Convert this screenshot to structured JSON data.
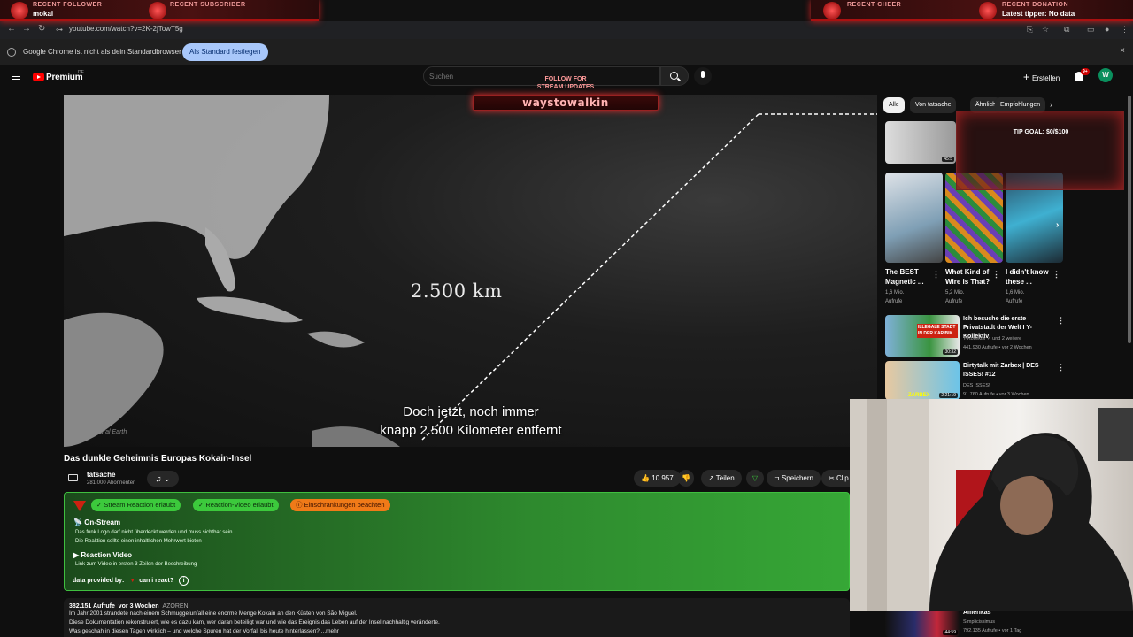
{
  "stream_overlay": {
    "recent_follower_label": "RECENT FOLLOWER",
    "recent_follower_name": "mokai",
    "recent_subscriber_label": "RECENT SUBSCRIBER",
    "recent_cheer_label": "RECENT CHEER",
    "recent_donation_label": "RECENT DONATION",
    "latest_tipper": "Latest tipper: No data",
    "follow_line1": "FOLLOW FOR",
    "follow_line2": "STREAM UPDATES",
    "channel_banner": "waystowalkin",
    "tip_goal": "TIP GOAL: $0/$100"
  },
  "browser": {
    "url": "youtube.com/watch?v=2K-2jTowT5g",
    "info_text": "Google Chrome ist nicht als dein Standardbrowser festgelegt",
    "default_button": "Als Standard festlegen",
    "close_glyph": "×"
  },
  "header": {
    "brand": "Premium",
    "brand_sup": "DE",
    "search_placeholder": "Suchen",
    "create_label": "Erstellen",
    "notif_count": "9+",
    "avatar_letter": "W"
  },
  "video": {
    "distance_label": "2.500 km",
    "caption_line1": "Doch jetzt, noch immer",
    "caption_line2": "knapp 2.500 Kilometer entfernt",
    "watermark": "Natural Earth",
    "title": "Das dunkle Geheimnis Europas Kokain-Insel",
    "channel": "tatsache",
    "subscribers": "281.000 Abonnenten",
    "likes": "10.957",
    "share_label": "Teilen",
    "save_label": "Speichern",
    "clip_label": "Clip"
  },
  "reaction_panel": {
    "pill_stream": "Stream Reaction erlaubt",
    "pill_video": "Reaction-Video erlaubt",
    "pill_restrictions": "Einschränkungen beachten",
    "on_stream_title": "On-Stream",
    "on_stream_1": "Das funk Logo darf nicht überdeckt werden und muss sichtbar sein",
    "on_stream_2": "Die Reaktion sollte einen inhaltlichen Mehrwert bieten",
    "reaction_video_title": "Reaction Video",
    "reaction_video_1": "Link zum Video in ersten 3 Zeilen der Beschreibung",
    "provided_by": "data provided by:",
    "provider": "can i react?"
  },
  "description": {
    "views": "382.151 Aufrufe",
    "age": "vor 3 Wochen",
    "tag": "AZOREN",
    "line1": "Im Jahr 2001 strandete nach einem Schmuggelunfall eine enorme Menge Kokain an den Küsten von São Miguel.",
    "line2": "Diese Dokumentation rekonstruiert, wie es dazu kam, wer daran beteiligt war und wie das Ereignis das Leben auf der Insel nachhaltig veränderte.",
    "line3": "Was geschah in diesen Tagen wirklich – und welche Spuren hat der Vorfall bis heute hinterlassen? ...mehr"
  },
  "sidebar": {
    "chips": [
      "Alle",
      "Von tatsache",
      "Ähnlich",
      "Empfohlungen"
    ],
    "chip_arrow": "›",
    "first_thumb_duration": "45:5",
    "shorts": [
      {
        "title": "The BEST Magnetic ...",
        "views": "1,6 Mio.",
        "label": "Aufrufe"
      },
      {
        "title": "What Kind of Wire is That?",
        "views": "5,2 Mio.",
        "label": "Aufrufe"
      },
      {
        "title": "I didn't know these ...",
        "views": "1,6 Mio.",
        "label": "Aufrufe"
      }
    ],
    "videos": [
      {
        "title": "Ich besuche die erste Privatstadt der Welt I Y-Kollektiv",
        "channel": "Y-Kollektiv",
        "extra": "und 2 weitere",
        "meta": "441.930 Aufrufe • vor 2 Wochen",
        "duration": "30:32",
        "thumb_text": "ILLEGALE STADT IN DER KARIBIK"
      },
      {
        "title": "Dirtytalk mit Zarbex | DES ISSES! #12",
        "channel": "DES ISSES!",
        "meta": "91.760 Aufrufe • vor 3 Wochen",
        "duration": "2:21:19",
        "thumb_text": "ZARBEX"
      },
      {
        "title": "Amerikas",
        "channel": "Simplicissimus",
        "meta": "792.135 Aufrufe • vor 1 Tag",
        "duration": "44:59"
      }
    ]
  },
  "colors": {
    "accent_red": "#ff0000",
    "panel_green": "#2e8a2e",
    "pill_ok": "#3cc93c",
    "pill_warn": "#f07a18"
  }
}
